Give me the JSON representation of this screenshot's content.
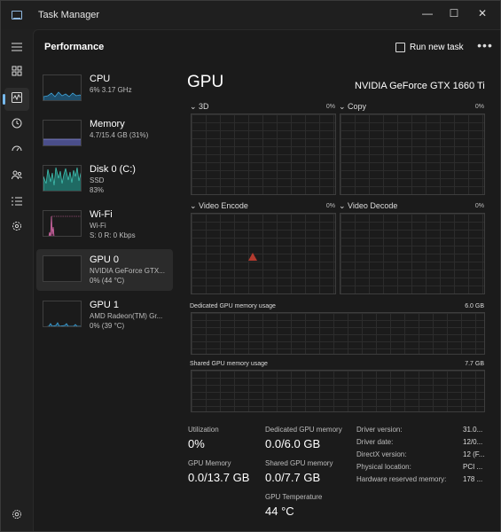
{
  "window": {
    "title": "Task Manager",
    "minimize": "—",
    "maximize": "☐",
    "close": "✕"
  },
  "header": {
    "title": "Performance",
    "run_new_task": "Run new task",
    "more": "•••"
  },
  "devices": [
    {
      "name": "CPU",
      "sub1": "6% 3.17 GHz",
      "sub2": ""
    },
    {
      "name": "Memory",
      "sub1": "4.7/15.4 GB (31%)",
      "sub2": ""
    },
    {
      "name": "Disk 0 (C:)",
      "sub1": "SSD",
      "sub2": "83%"
    },
    {
      "name": "Wi-Fi",
      "sub1": "Wi-Fi",
      "sub2": "S: 0 R: 0 Kbps"
    },
    {
      "name": "GPU 0",
      "sub1": "NVIDIA GeForce GTX...",
      "sub2": "0% (44 °C)"
    },
    {
      "name": "GPU 1",
      "sub1": "AMD Radeon(TM) Gr...",
      "sub2": "0% (39 °C)"
    }
  ],
  "detail": {
    "title": "GPU",
    "model": "NVIDIA GeForce GTX 1660 Ti",
    "engines": [
      {
        "label": "3D",
        "pct": "0%"
      },
      {
        "label": "Copy",
        "pct": "0%"
      },
      {
        "label": "Video Encode",
        "pct": "0%"
      },
      {
        "label": "Video Decode",
        "pct": "0%"
      }
    ],
    "dedicated": {
      "label": "Dedicated GPU memory usage",
      "max": "6.0 GB"
    },
    "shared": {
      "label": "Shared GPU memory usage",
      "max": "7.7 GB"
    },
    "stats": {
      "utilization_label": "Utilization",
      "utilization": "0%",
      "gpu_memory_label": "GPU Memory",
      "gpu_memory": "0.0/13.7 GB",
      "dedicated_label": "Dedicated GPU memory",
      "dedicated": "0.0/6.0 GB",
      "shared_label": "Shared GPU memory",
      "shared": "0.0/7.7 GB",
      "temp_label": "GPU Temperature",
      "temp": "44 °C"
    },
    "driver": [
      {
        "label": "Driver version:",
        "value": "31.0..."
      },
      {
        "label": "Driver date:",
        "value": "12/0..."
      },
      {
        "label": "DirectX version:",
        "value": "12 (F..."
      },
      {
        "label": "Physical location:",
        "value": "PCI ..."
      },
      {
        "label": "Hardware reserved memory:",
        "value": "178 ..."
      }
    ]
  },
  "colors": {
    "cpu": "#3fa2d6",
    "memory": "#8a8fd6",
    "disk": "#3fbfb0",
    "wifi": "#d66aa8",
    "gpu": "#3fa2d6"
  }
}
